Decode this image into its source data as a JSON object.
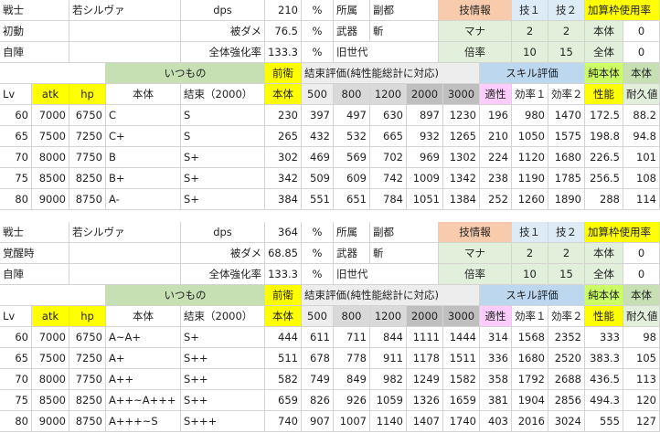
{
  "blocks": [
    {
      "info": {
        "class": "戦士",
        "name": "若シルヴァ",
        "dps_label": "dps",
        "dps": "210",
        "pct": "%",
        "shozoku_label": "所属",
        "shozoku": "副都",
        "waza_label": "技情報",
        "waza1": "技１",
        "waza2": "技２",
        "kasan_label": "加算枠使用率",
        "mode": "初動",
        "hidame_label": "被ダメ",
        "hidame": "76.5",
        "pct2": "%",
        "buki_label": "武器",
        "buki": "斬",
        "mana_label": "マナ",
        "mana1": "2",
        "mana2": "2",
        "hontai_label": "本体",
        "hontai_val": "0",
        "jin": "自陣",
        "kyoka_label": "全体強化率",
        "kyoka": "133.3",
        "pct3": "%",
        "sedai": "旧世代",
        "bairitsu_label": "倍率",
        "bairitsu1": "10",
        "bairitsu2": "15",
        "zentai_label": "全体",
        "zentai_val": "0"
      },
      "headers": {
        "itsumono": "いつもの",
        "zenei": "前衛",
        "kessoku_hyoka": "結束評価(純性能総計に対応)",
        "skill_hyoka": "スキル評価",
        "jun_hontai": "純本体",
        "hontai2": "本体",
        "lv": "Lv",
        "atk": "atk",
        "hp": "hp",
        "hontai": "本体",
        "kessoku": "結束（2000）",
        "zenei_hontai": "本体",
        "k500": "500",
        "k800": "800",
        "k1200": "1200",
        "k2000": "2000",
        "k3000": "3000",
        "tekisei": "適性",
        "koritsu1": "効率１",
        "koritsu2": "効率２",
        "seino": "性能",
        "taikyu": "耐久値"
      },
      "rows": [
        [
          "60",
          "7000",
          "6750",
          "C",
          "S",
          "230",
          "397",
          "497",
          "630",
          "897",
          "1230",
          "196",
          "980",
          "1470",
          "172.5",
          "88.2"
        ],
        [
          "65",
          "7500",
          "7250",
          "C+",
          "S",
          "265",
          "432",
          "532",
          "665",
          "932",
          "1265",
          "210",
          "1050",
          "1575",
          "198.8",
          "94.8"
        ],
        [
          "70",
          "8000",
          "7750",
          "B",
          "S+",
          "302",
          "469",
          "569",
          "702",
          "969",
          "1302",
          "224",
          "1120",
          "1680",
          "226.5",
          "101"
        ],
        [
          "75",
          "8500",
          "8250",
          "B+",
          "S+",
          "342",
          "509",
          "609",
          "742",
          "1009",
          "1342",
          "238",
          "1190",
          "1785",
          "256.5",
          "108"
        ],
        [
          "80",
          "9000",
          "8750",
          "A-",
          "S+",
          "384",
          "551",
          "651",
          "784",
          "1051",
          "1384",
          "252",
          "1260",
          "1890",
          "288",
          "114"
        ]
      ]
    },
    {
      "info": {
        "class": "戦士",
        "name": "若シルヴァ",
        "dps_label": "dps",
        "dps": "364",
        "pct": "%",
        "shozoku_label": "所属",
        "shozoku": "副都",
        "waza_label": "技情報",
        "waza1": "技１",
        "waza2": "技２",
        "kasan_label": "加算枠使用率",
        "mode": "覚醒時",
        "hidame_label": "被ダメ",
        "hidame": "68.85",
        "pct2": "%",
        "buki_label": "武器",
        "buki": "斬",
        "mana_label": "マナ",
        "mana1": "2",
        "mana2": "2",
        "hontai_label": "本体",
        "hontai_val": "0",
        "jin": "自陣",
        "kyoka_label": "全体強化率",
        "kyoka": "133.3",
        "pct3": "%",
        "sedai": "旧世代",
        "bairitsu_label": "倍率",
        "bairitsu1": "10",
        "bairitsu2": "15",
        "zentai_label": "全体",
        "zentai_val": "0"
      },
      "headers": {
        "itsumono": "いつもの",
        "zenei": "前衛",
        "kessoku_hyoka": "結束評価(純性能総計に対応)",
        "skill_hyoka": "スキル評価",
        "jun_hontai": "純本体",
        "hontai2": "本体",
        "lv": "Lv",
        "atk": "atk",
        "hp": "hp",
        "hontai": "本体",
        "kessoku": "結束（2000）",
        "zenei_hontai": "本体",
        "k500": "500",
        "k800": "800",
        "k1200": "1200",
        "k2000": "2000",
        "k3000": "3000",
        "tekisei": "適性",
        "koritsu1": "効率１",
        "koritsu2": "効率２",
        "seino": "性能",
        "taikyu": "耐久値"
      },
      "rows": [
        [
          "60",
          "7000",
          "6750",
          "A~A+",
          "S+",
          "444",
          "611",
          "711",
          "844",
          "1111",
          "1444",
          "314",
          "1568",
          "2352",
          "333",
          "98"
        ],
        [
          "65",
          "7500",
          "7250",
          "A+",
          "S++",
          "511",
          "678",
          "778",
          "911",
          "1178",
          "1511",
          "336",
          "1680",
          "2520",
          "383.3",
          "105"
        ],
        [
          "70",
          "8000",
          "7750",
          "A++",
          "S++",
          "582",
          "749",
          "849",
          "982",
          "1249",
          "1582",
          "358",
          "1792",
          "2688",
          "436.5",
          "113"
        ],
        [
          "75",
          "8500",
          "8250",
          "A++~A+++",
          "S++",
          "659",
          "826",
          "926",
          "1059",
          "1326",
          "1659",
          "381",
          "1904",
          "2856",
          "494.3",
          "120"
        ],
        [
          "80",
          "9000",
          "8750",
          "A+++~S",
          "S+++",
          "740",
          "907",
          "1007",
          "1140",
          "1407",
          "1740",
          "403",
          "2016",
          "3024",
          "555",
          "127"
        ]
      ]
    }
  ]
}
